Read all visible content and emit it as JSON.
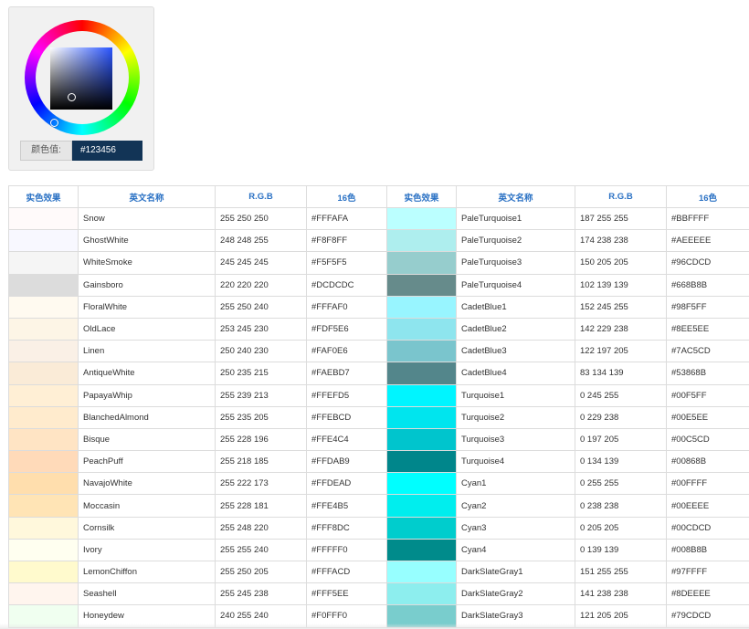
{
  "picker": {
    "label": "颜色值:",
    "value": "#123456"
  },
  "table": {
    "headers": [
      "实色效果",
      "英文名称",
      "R.G.B",
      "16色",
      "实色效果",
      "英文名称",
      "R.G.B",
      "16色"
    ],
    "rows": [
      {
        "left": {
          "name": "Snow",
          "rgb": "255 250 250",
          "hex": "#FFFAFA",
          "color": "#FFFAFA"
        },
        "right": {
          "name": "PaleTurquoise1",
          "rgb": "187 255 255",
          "hex": "#BBFFFF",
          "color": "#BBFFFF"
        }
      },
      {
        "left": {
          "name": "GhostWhite",
          "rgb": "248 248 255",
          "hex": "#F8F8FF",
          "color": "#F8F8FF"
        },
        "right": {
          "name": "PaleTurquoise2",
          "rgb": "174 238 238",
          "hex": "#AEEEEE",
          "color": "#AEEEEE"
        }
      },
      {
        "left": {
          "name": "WhiteSmoke",
          "rgb": "245 245 245",
          "hex": "#F5F5F5",
          "color": "#F5F5F5"
        },
        "right": {
          "name": "PaleTurquoise3",
          "rgb": "150 205 205",
          "hex": "#96CDCD",
          "color": "#96CDCD"
        }
      },
      {
        "left": {
          "name": "Gainsboro",
          "rgb": "220 220 220",
          "hex": "#DCDCDC",
          "color": "#DCDCDC"
        },
        "right": {
          "name": "PaleTurquoise4",
          "rgb": "102 139 139",
          "hex": "#668B8B",
          "color": "#668B8B"
        }
      },
      {
        "left": {
          "name": "FloralWhite",
          "rgb": "255 250 240",
          "hex": "#FFFAF0",
          "color": "#FFFAF0"
        },
        "right": {
          "name": "CadetBlue1",
          "rgb": "152 245 255",
          "hex": "#98F5FF",
          "color": "#98F5FF"
        }
      },
      {
        "left": {
          "name": "OldLace",
          "rgb": "253 245 230",
          "hex": "#FDF5E6",
          "color": "#FDF5E6"
        },
        "right": {
          "name": "CadetBlue2",
          "rgb": "142 229 238",
          "hex": "#8EE5EE",
          "color": "#8EE5EE"
        }
      },
      {
        "left": {
          "name": "Linen",
          "rgb": "250 240 230",
          "hex": "#FAF0E6",
          "color": "#FAF0E6"
        },
        "right": {
          "name": "CadetBlue3",
          "rgb": "122 197 205",
          "hex": "#7AC5CD",
          "color": "#7AC5CD"
        }
      },
      {
        "left": {
          "name": "AntiqueWhite",
          "rgb": "250 235 215",
          "hex": "#FAEBD7",
          "color": "#FAEBD7"
        },
        "right": {
          "name": "CadetBlue4",
          "rgb": "83 134 139",
          "hex": "#53868B",
          "color": "#53868B"
        }
      },
      {
        "left": {
          "name": "PapayaWhip",
          "rgb": "255 239 213",
          "hex": "#FFEFD5",
          "color": "#FFEFD5"
        },
        "right": {
          "name": "Turquoise1",
          "rgb": "0 245 255",
          "hex": "#00F5FF",
          "color": "#00F5FF"
        }
      },
      {
        "left": {
          "name": "BlanchedAlmond",
          "rgb": "255 235 205",
          "hex": "#FFEBCD",
          "color": "#FFEBCD"
        },
        "right": {
          "name": "Turquoise2",
          "rgb": "0 229 238",
          "hex": "#00E5EE",
          "color": "#00E5EE"
        }
      },
      {
        "left": {
          "name": "Bisque",
          "rgb": "255 228 196",
          "hex": "#FFE4C4",
          "color": "#FFE4C4"
        },
        "right": {
          "name": "Turquoise3",
          "rgb": "0 197 205",
          "hex": "#00C5CD",
          "color": "#00C5CD"
        }
      },
      {
        "left": {
          "name": "PeachPuff",
          "rgb": "255 218 185",
          "hex": "#FFDAB9",
          "color": "#FFDAB9"
        },
        "right": {
          "name": "Turquoise4",
          "rgb": "0 134 139",
          "hex": "#00868B",
          "color": "#00868B"
        }
      },
      {
        "left": {
          "name": "NavajoWhite",
          "rgb": "255 222 173",
          "hex": "#FFDEAD",
          "color": "#FFDEAD"
        },
        "right": {
          "name": "Cyan1",
          "rgb": "0 255 255",
          "hex": "#00FFFF",
          "color": "#00FFFF"
        }
      },
      {
        "left": {
          "name": "Moccasin",
          "rgb": "255 228 181",
          "hex": "#FFE4B5",
          "color": "#FFE4B5"
        },
        "right": {
          "name": "Cyan2",
          "rgb": "0 238 238",
          "hex": "#00EEEE",
          "color": "#00EEEE"
        }
      },
      {
        "left": {
          "name": "Cornsilk",
          "rgb": "255 248 220",
          "hex": "#FFF8DC",
          "color": "#FFF8DC"
        },
        "right": {
          "name": "Cyan3",
          "rgb": "0 205 205",
          "hex": "#00CDCD",
          "color": "#00CDCD"
        }
      },
      {
        "left": {
          "name": "Ivory",
          "rgb": "255 255 240",
          "hex": "#FFFFF0",
          "color": "#FFFFF0"
        },
        "right": {
          "name": "Cyan4",
          "rgb": "0 139 139",
          "hex": "#008B8B",
          "color": "#008B8B"
        }
      },
      {
        "left": {
          "name": "LemonChiffon",
          "rgb": "255 250 205",
          "hex": "#FFFACD",
          "color": "#FFFACD"
        },
        "right": {
          "name": "DarkSlateGray1",
          "rgb": "151 255 255",
          "hex": "#97FFFF",
          "color": "#97FFFF"
        }
      },
      {
        "left": {
          "name": "Seashell",
          "rgb": "255 245 238",
          "hex": "#FFF5EE",
          "color": "#FFF5EE"
        },
        "right": {
          "name": "DarkSlateGray2",
          "rgb": "141 238 238",
          "hex": "#8DEEEE",
          "color": "#8DEEEE"
        }
      },
      {
        "left": {
          "name": "Honeydew",
          "rgb": "240 255 240",
          "hex": "#F0FFF0",
          "color": "#F0FFF0"
        },
        "right": {
          "name": "DarkSlateGray3",
          "rgb": "121 205 205",
          "hex": "#79CDCD",
          "color": "#79CDCD"
        }
      }
    ]
  }
}
